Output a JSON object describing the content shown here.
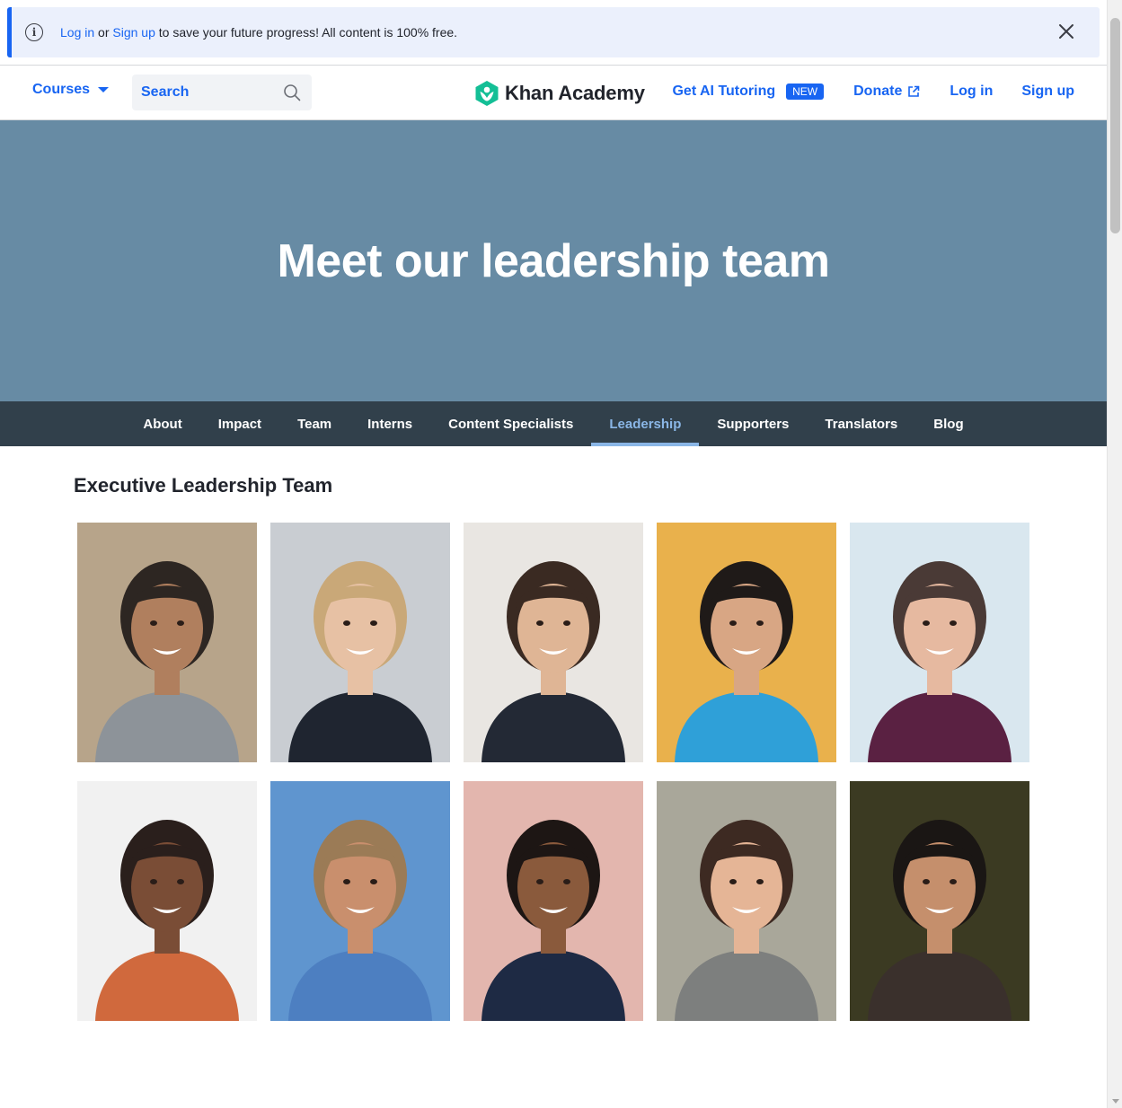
{
  "banner": {
    "login_link": "Log in",
    "or_text": " or ",
    "signup_link": "Sign up",
    "message": " to save your future progress! All content is 100% free."
  },
  "header": {
    "courses_label": "Courses",
    "search_placeholder": "Search",
    "brand": "Khan Academy",
    "ai_tutoring": "Get AI Tutoring",
    "new_badge": "NEW",
    "donate": "Donate",
    "login": "Log in",
    "signup": "Sign up"
  },
  "hero": {
    "title": "Meet our leadership team",
    "background": "#678ba4"
  },
  "subnav": {
    "tabs": [
      {
        "label": "About",
        "active": false
      },
      {
        "label": "Impact",
        "active": false
      },
      {
        "label": "Team",
        "active": false
      },
      {
        "label": "Interns",
        "active": false
      },
      {
        "label": "Content Specialists",
        "active": false
      },
      {
        "label": "Leadership",
        "active": true
      },
      {
        "label": "Supporters",
        "active": false
      },
      {
        "label": "Translators",
        "active": false
      },
      {
        "label": "Blog",
        "active": false
      }
    ]
  },
  "section": {
    "title": "Executive Leadership Team"
  },
  "colors": {
    "accent": "#1865f2",
    "subnav_bg": "#31404b",
    "active_tab": "#8ab6e6",
    "brand_green": "#14bf96"
  },
  "portraits": [
    {
      "bg": "#b7a48a",
      "hair": "#2d2622",
      "skin": "#b07f5e",
      "top": "#8d9399"
    },
    {
      "bg": "#c9cdd2",
      "hair": "#c9a878",
      "skin": "#e7c1a4",
      "top": "#1f2530"
    },
    {
      "bg": "#e9e6e2",
      "hair": "#3a2a22",
      "skin": "#dfb595",
      "top": "#232935"
    },
    {
      "bg": "#e9b14c",
      "hair": "#1f1a18",
      "skin": "#d8a684",
      "top": "#2fa0d8"
    },
    {
      "bg": "#d9e7ef",
      "hair": "#4a3a36",
      "skin": "#e6b9a0",
      "top": "#5a2142"
    },
    {
      "bg": "#f1f1f1",
      "hair": "#2a1f1c",
      "skin": "#7a4d36",
      "top": "#d0693d"
    },
    {
      "bg": "#5f95cf",
      "hair": "#9b7b56",
      "skin": "#c98f6d",
      "top": "#4d7fc1"
    },
    {
      "bg": "#e3b6ae",
      "hair": "#1d1614",
      "skin": "#8a5a3c",
      "top": "#1e2a44"
    },
    {
      "bg": "#a9a79a",
      "hair": "#3d2a22",
      "skin": "#e5b596",
      "top": "#7d7f7e"
    },
    {
      "bg": "#3b3a22",
      "hair": "#1a1614",
      "skin": "#c58f6c",
      "top": "#3a302c"
    }
  ]
}
